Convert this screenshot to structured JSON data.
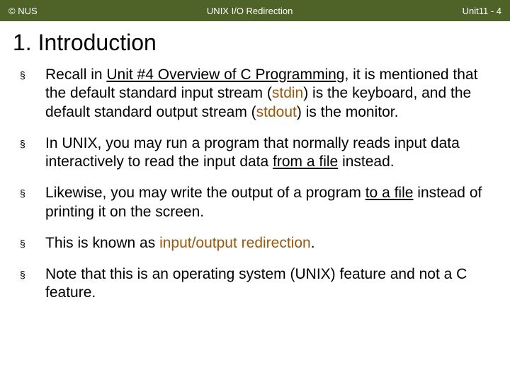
{
  "header": {
    "copyright": "© NUS",
    "title": "UNIX I/O Redirection",
    "pageref": "Unit11 - 4"
  },
  "slide": {
    "title": "1. Introduction"
  },
  "bullets": {
    "b1": {
      "t1": "Recall in ",
      "t2": "Unit #4 Overview of C Programming",
      "t3": ", it is mentioned that the default standard input stream (",
      "t4": "stdin",
      "t5": ") is the keyboard, and the default standard output stream (",
      "t6": "stdout",
      "t7": ") is the monitor."
    },
    "b2": {
      "t1": "In UNIX, you may run a program that normally reads input data interactively to read the input data ",
      "t2": "from a file",
      "t3": " instead."
    },
    "b3": {
      "t1": "Likewise, you may write the output of a program ",
      "t2": "to a file",
      "t3": " instead of printing it on the screen."
    },
    "b4": {
      "t1": "This is known as ",
      "t2": "input/output redirection",
      "t3": "."
    },
    "b5": {
      "t1": "Note that this is an operating system (UNIX) feature and not a C feature."
    }
  }
}
